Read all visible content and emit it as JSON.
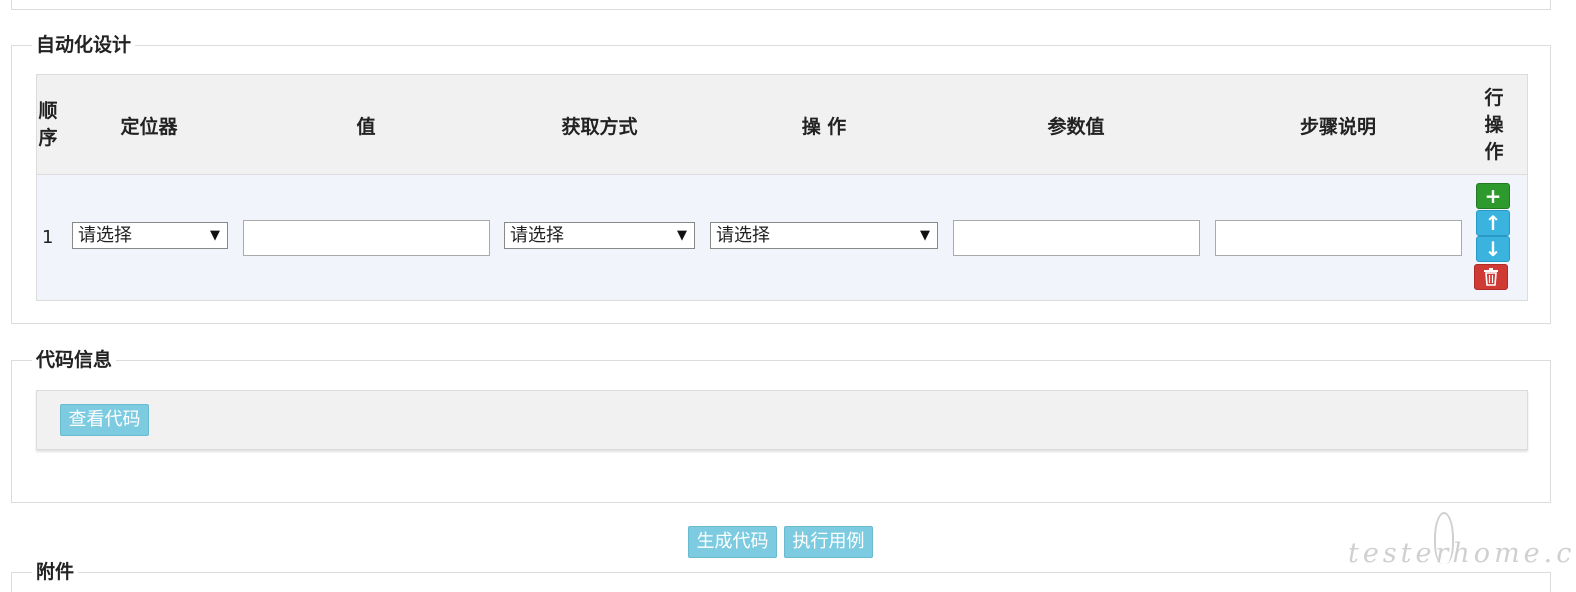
{
  "design": {
    "legend": "自动化设计",
    "columns": {
      "seq": "顺序",
      "locator": "定位器",
      "value": "值",
      "method": "获取方式",
      "action": "操 作",
      "param": "参数值",
      "desc": "步骤说明",
      "rowop": "行操作"
    },
    "rows": [
      {
        "seq": "1",
        "locator_select": "请选择",
        "value_input": "",
        "method_select": "请选择",
        "action_select": "请选择",
        "param_input": "",
        "desc_input": ""
      }
    ],
    "row_ops": {
      "add": "+",
      "up": "↑",
      "down": "↓",
      "delete": "🗑"
    },
    "colors": {
      "add": "#2e9a2e",
      "move": "#3bb3df",
      "delete": "#cf3a34"
    }
  },
  "code": {
    "legend": "代码信息",
    "view_code_button": "查看代码"
  },
  "actions": {
    "generate_code_button": "生成代码",
    "run_case_button": "执行用例"
  },
  "attach": {
    "legend": "附件"
  },
  "watermark": "testerhome.com",
  "select_arrow": "▼"
}
